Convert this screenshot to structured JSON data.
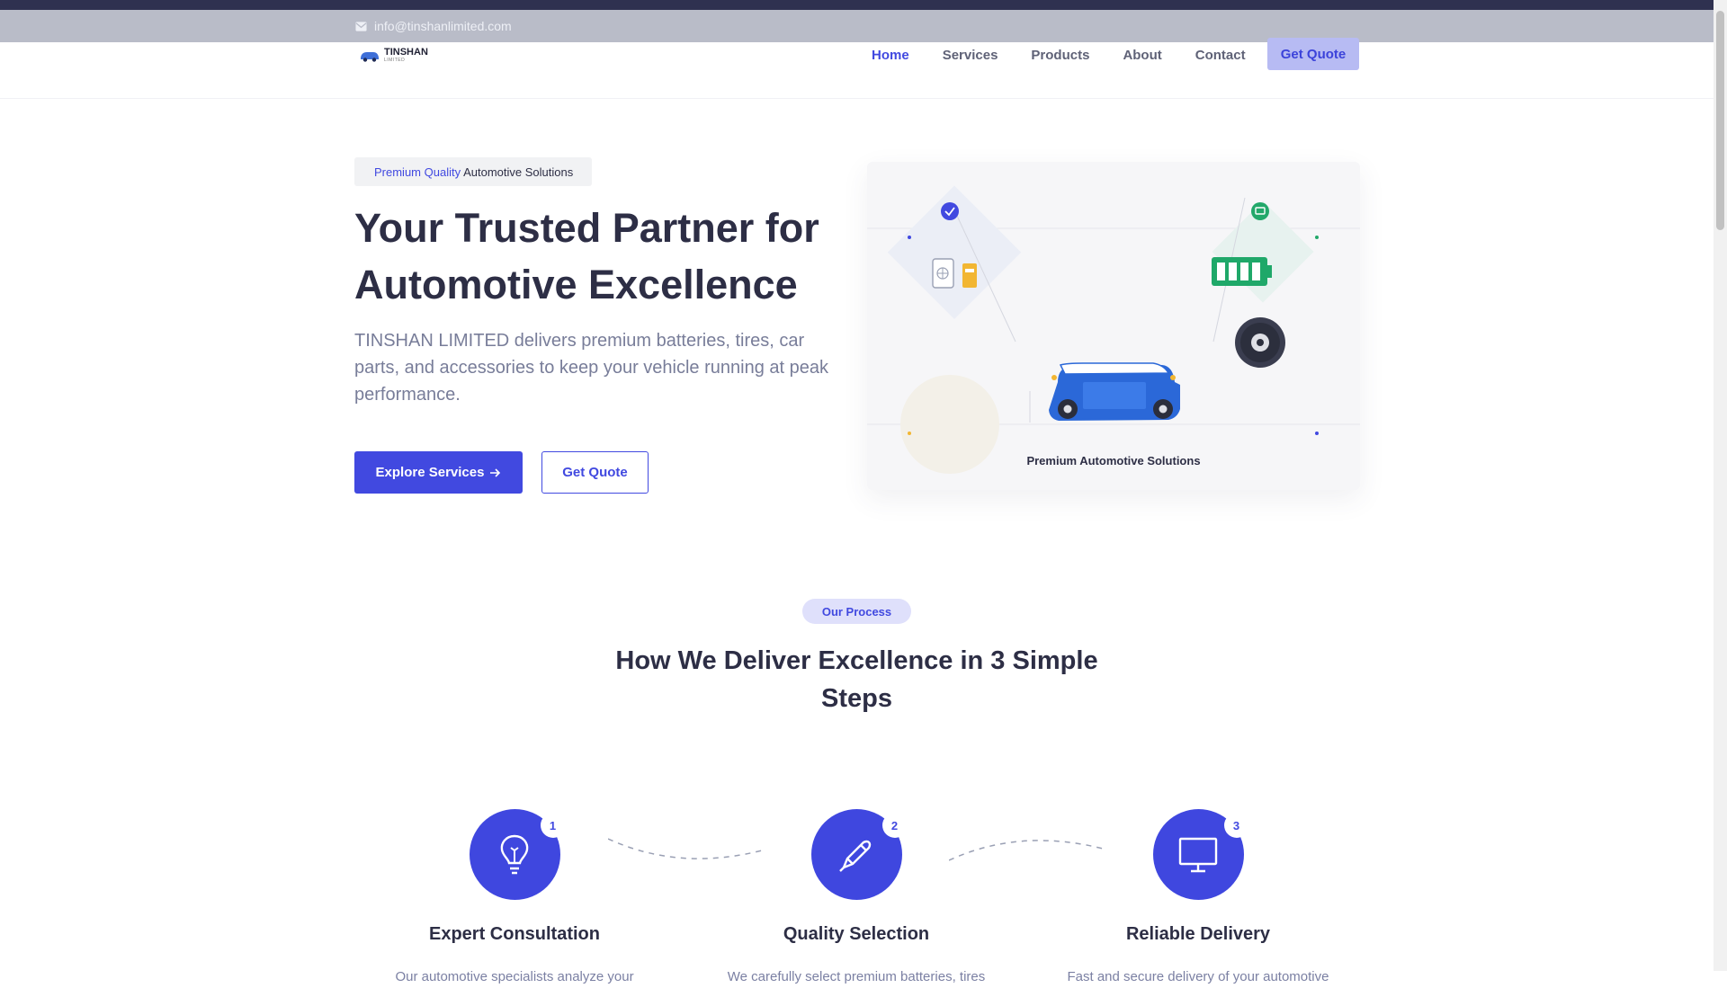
{
  "topbar": {
    "email": "info@tinshanlimited.com",
    "icon": "mail-icon"
  },
  "brand": {
    "name": "TINSHAN",
    "sub": "LIMITED",
    "logo": "car-logo-icon"
  },
  "nav": {
    "items": [
      "Home",
      "Services",
      "Products",
      "About",
      "Contact"
    ],
    "active": "Home",
    "cta": "Get Quote"
  },
  "hero": {
    "badge_highlight": "Premium Quality",
    "badge_rest": "Automotive Solutions",
    "title": "Your Trusted Partner for Automotive Excellence",
    "text": "TINSHAN LIMITED delivers premium batteries, tires, car parts, and accessories to keep your vehicle running at peak performance.",
    "primary_button": "Explore Services",
    "secondary_button": "Get Quote",
    "illustration_caption": "Premium Automotive Solutions"
  },
  "process": {
    "badge": "Our Process",
    "title": "How We Deliver Excellence in 3 Simple Steps",
    "steps": [
      {
        "number": "1",
        "title": "Expert Consultation",
        "description": "Our automotive specialists analyze your",
        "icon": "lightbulb-icon"
      },
      {
        "number": "2",
        "title": "Quality Selection",
        "description": "We carefully select premium batteries, tires",
        "icon": "pencil-icon"
      },
      {
        "number": "3",
        "title": "Reliable Delivery",
        "description": "Fast and secure delivery of your automotive",
        "icon": "monitor-icon"
      }
    ]
  },
  "colors": {
    "accent": "#4149e0",
    "dark": "#2d2e45",
    "topbar": "#b9bcc8",
    "stripe": "#2f3150",
    "battery": "#22a86a"
  }
}
